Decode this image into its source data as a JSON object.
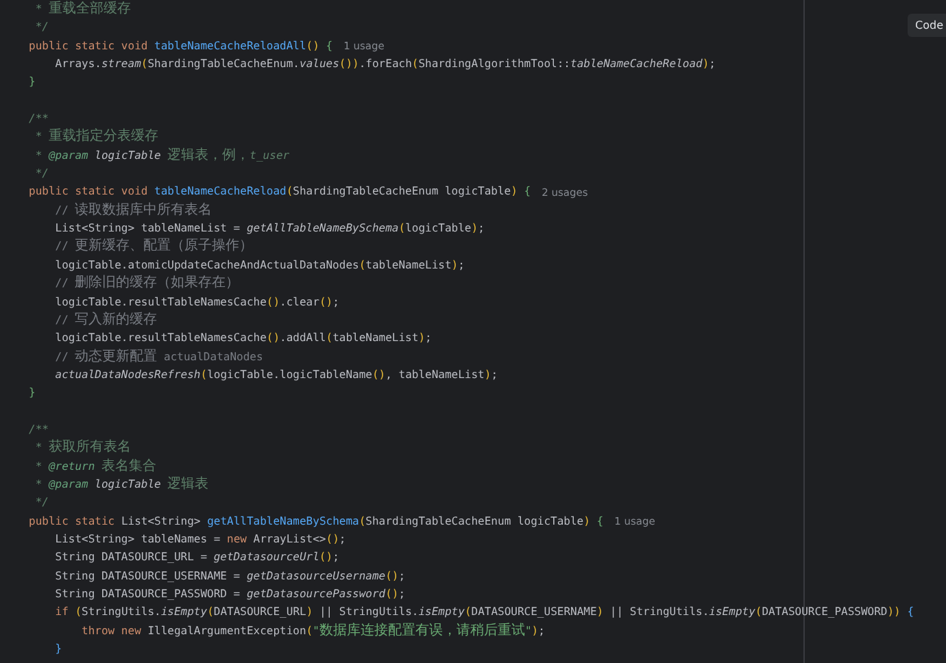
{
  "editor": {
    "lines": [
      {
        "kind": "code",
        "tokens": [
          {
            "text": " * 重载全部缓存",
            "kind": "doc"
          }
        ]
      },
      {
        "kind": "code",
        "tokens": [
          {
            "text": " */",
            "kind": "doc"
          }
        ]
      },
      {
        "kind": "code",
        "tokens": [
          {
            "text": "public static void ",
            "kind": "kw"
          },
          {
            "text": "tableNameCacheReloadAll",
            "kind": "decl"
          },
          {
            "text": "() ",
            "kind": "paren"
          },
          {
            "text": "{",
            "kind": "brace"
          }
        ],
        "hint": "1 usage"
      },
      {
        "kind": "code",
        "tokens": [
          {
            "text": "    Arrays.",
            "kind": "plain"
          },
          {
            "text": "stream",
            "kind": "static"
          },
          {
            "text": "(",
            "kind": "paren"
          },
          {
            "text": "ShardingTableCacheEnum.",
            "kind": "plain"
          },
          {
            "text": "values",
            "kind": "static"
          },
          {
            "text": "())",
            "kind": "paren"
          },
          {
            "text": ".forEach",
            "kind": "plain"
          },
          {
            "text": "(",
            "kind": "paren"
          },
          {
            "text": "ShardingAlgorithmTool::",
            "kind": "plain"
          },
          {
            "text": "tableNameCacheReload",
            "kind": "static"
          },
          {
            "text": ")",
            "kind": "paren"
          },
          {
            "text": ";",
            "kind": "plain"
          }
        ]
      },
      {
        "kind": "code",
        "tokens": [
          {
            "text": "}",
            "kind": "brace"
          }
        ]
      },
      {
        "kind": "blank"
      },
      {
        "kind": "code",
        "tokens": [
          {
            "text": "/**",
            "kind": "doc"
          }
        ]
      },
      {
        "kind": "code",
        "tokens": [
          {
            "text": " * 重载指定分表缓存",
            "kind": "doc"
          }
        ]
      },
      {
        "kind": "code",
        "tokens": [
          {
            "text": " * ",
            "kind": "doc"
          },
          {
            "text": "@param ",
            "kind": "doctag"
          },
          {
            "text": "logicTable",
            "kind": "docparam"
          },
          {
            "text": " 逻辑表，例，t_user",
            "kind": "doc"
          }
        ]
      },
      {
        "kind": "code",
        "tokens": [
          {
            "text": " */",
            "kind": "doc"
          }
        ]
      },
      {
        "kind": "code",
        "tokens": [
          {
            "text": "public static void ",
            "kind": "kw"
          },
          {
            "text": "tableNameCacheReload",
            "kind": "decl"
          },
          {
            "text": "(",
            "kind": "paren"
          },
          {
            "text": "ShardingTableCacheEnum logicTable",
            "kind": "plain"
          },
          {
            "text": ") ",
            "kind": "paren"
          },
          {
            "text": "{",
            "kind": "brace"
          }
        ],
        "hint": "2 usages"
      },
      {
        "kind": "code",
        "tokens": [
          {
            "text": "    // 读取数据库中所有表名",
            "kind": "comment"
          }
        ]
      },
      {
        "kind": "code",
        "tokens": [
          {
            "text": "    List<String> tableNameList = ",
            "kind": "plain"
          },
          {
            "text": "getAllTableNameBySchema",
            "kind": "static"
          },
          {
            "text": "(",
            "kind": "paren"
          },
          {
            "text": "logicTable",
            "kind": "plain"
          },
          {
            "text": ")",
            "kind": "paren"
          },
          {
            "text": ";",
            "kind": "plain"
          }
        ]
      },
      {
        "kind": "code",
        "tokens": [
          {
            "text": "    // 更新缓存、配置（原子操作）",
            "kind": "comment"
          }
        ]
      },
      {
        "kind": "code",
        "tokens": [
          {
            "text": "    logicTable.atomicUpdateCacheAndActualDataNodes",
            "kind": "plain"
          },
          {
            "text": "(",
            "kind": "paren"
          },
          {
            "text": "tableNameList",
            "kind": "plain"
          },
          {
            "text": ")",
            "kind": "paren"
          },
          {
            "text": ";",
            "kind": "plain"
          }
        ]
      },
      {
        "kind": "code",
        "tokens": [
          {
            "text": "    // 删除旧的缓存（如果存在）",
            "kind": "comment"
          }
        ]
      },
      {
        "kind": "code",
        "tokens": [
          {
            "text": "    logicTable.resultTableNamesCache",
            "kind": "plain"
          },
          {
            "text": "()",
            "kind": "paren"
          },
          {
            "text": ".clear",
            "kind": "plain"
          },
          {
            "text": "()",
            "kind": "paren"
          },
          {
            "text": ";",
            "kind": "plain"
          }
        ]
      },
      {
        "kind": "code",
        "tokens": [
          {
            "text": "    // 写入新的缓存",
            "kind": "comment"
          }
        ]
      },
      {
        "kind": "code",
        "tokens": [
          {
            "text": "    logicTable.resultTableNamesCache",
            "kind": "plain"
          },
          {
            "text": "()",
            "kind": "paren"
          },
          {
            "text": ".addAll",
            "kind": "plain"
          },
          {
            "text": "(",
            "kind": "paren"
          },
          {
            "text": "tableNameList",
            "kind": "plain"
          },
          {
            "text": ")",
            "kind": "paren"
          },
          {
            "text": ";",
            "kind": "plain"
          }
        ]
      },
      {
        "kind": "code",
        "tokens": [
          {
            "text": "    // 动态更新配置 actualDataNodes",
            "kind": "comment"
          }
        ]
      },
      {
        "kind": "code",
        "tokens": [
          {
            "text": "    actualDataNodesRefresh",
            "kind": "static"
          },
          {
            "text": "(",
            "kind": "paren"
          },
          {
            "text": "logicTable.logicTableName",
            "kind": "plain"
          },
          {
            "text": "()",
            "kind": "paren"
          },
          {
            "text": ", tableNameList",
            "kind": "plain"
          },
          {
            "text": ")",
            "kind": "paren"
          },
          {
            "text": ";",
            "kind": "plain"
          }
        ]
      },
      {
        "kind": "code",
        "tokens": [
          {
            "text": "}",
            "kind": "brace"
          }
        ]
      },
      {
        "kind": "blank"
      },
      {
        "kind": "code",
        "tokens": [
          {
            "text": "/**",
            "kind": "doc"
          }
        ]
      },
      {
        "kind": "code",
        "tokens": [
          {
            "text": " * 获取所有表名",
            "kind": "doc"
          }
        ]
      },
      {
        "kind": "code",
        "tokens": [
          {
            "text": " * ",
            "kind": "doc"
          },
          {
            "text": "@return",
            "kind": "doctag"
          },
          {
            "text": " 表名集合",
            "kind": "doc"
          }
        ]
      },
      {
        "kind": "code",
        "tokens": [
          {
            "text": " * ",
            "kind": "doc"
          },
          {
            "text": "@param ",
            "kind": "doctag"
          },
          {
            "text": "logicTable",
            "kind": "docparam"
          },
          {
            "text": " 逻辑表",
            "kind": "doc"
          }
        ]
      },
      {
        "kind": "code",
        "tokens": [
          {
            "text": " */",
            "kind": "doc"
          }
        ]
      },
      {
        "kind": "code",
        "tokens": [
          {
            "text": "public static ",
            "kind": "kw"
          },
          {
            "text": "List<String> ",
            "kind": "plain"
          },
          {
            "text": "getAllTableNameBySchema",
            "kind": "decl"
          },
          {
            "text": "(",
            "kind": "paren"
          },
          {
            "text": "ShardingTableCacheEnum logicTable",
            "kind": "plain"
          },
          {
            "text": ") ",
            "kind": "paren"
          },
          {
            "text": "{",
            "kind": "brace"
          }
        ],
        "hint": "1 usage"
      },
      {
        "kind": "code",
        "tokens": [
          {
            "text": "    List<String> tableNames = ",
            "kind": "plain"
          },
          {
            "text": "new ",
            "kind": "kw"
          },
          {
            "text": "ArrayList<>",
            "kind": "plain"
          },
          {
            "text": "()",
            "kind": "paren"
          },
          {
            "text": ";",
            "kind": "plain"
          }
        ]
      },
      {
        "kind": "code",
        "tokens": [
          {
            "text": "    String DATASOURCE_URL = ",
            "kind": "plain"
          },
          {
            "text": "getDatasourceUrl",
            "kind": "static"
          },
          {
            "text": "()",
            "kind": "paren"
          },
          {
            "text": ";",
            "kind": "plain"
          }
        ]
      },
      {
        "kind": "code",
        "tokens": [
          {
            "text": "    String DATASOURCE_USERNAME = ",
            "kind": "plain"
          },
          {
            "text": "getDatasourceUsername",
            "kind": "static"
          },
          {
            "text": "()",
            "kind": "paren"
          },
          {
            "text": ";",
            "kind": "plain"
          }
        ]
      },
      {
        "kind": "code",
        "tokens": [
          {
            "text": "    String DATASOURCE_PASSWORD = ",
            "kind": "plain"
          },
          {
            "text": "getDatasourcePassword",
            "kind": "static"
          },
          {
            "text": "()",
            "kind": "paren"
          },
          {
            "text": ";",
            "kind": "plain"
          }
        ]
      },
      {
        "kind": "code",
        "tokens": [
          {
            "text": "    if ",
            "kind": "kw"
          },
          {
            "text": "(",
            "kind": "paren"
          },
          {
            "text": "StringUtils.",
            "kind": "plain"
          },
          {
            "text": "isEmpty",
            "kind": "static"
          },
          {
            "text": "(",
            "kind": "paren"
          },
          {
            "text": "DATASOURCE_URL",
            "kind": "plain"
          },
          {
            "text": ")",
            "kind": "paren"
          },
          {
            "text": " || StringUtils.",
            "kind": "plain"
          },
          {
            "text": "isEmpty",
            "kind": "static"
          },
          {
            "text": "(",
            "kind": "paren"
          },
          {
            "text": "DATASOURCE_USERNAME",
            "kind": "plain"
          },
          {
            "text": ")",
            "kind": "paren"
          },
          {
            "text": " || StringUtils.",
            "kind": "plain"
          },
          {
            "text": "isEmpty",
            "kind": "static"
          },
          {
            "text": "(",
            "kind": "paren"
          },
          {
            "text": "DATASOURCE_PASSWORD",
            "kind": "plain"
          },
          {
            "text": ")) ",
            "kind": "paren"
          },
          {
            "text": "{",
            "kind": "brace2"
          }
        ]
      },
      {
        "kind": "code",
        "tokens": [
          {
            "text": "        throw new ",
            "kind": "kw"
          },
          {
            "text": "IllegalArgumentException",
            "kind": "plain"
          },
          {
            "text": "(",
            "kind": "paren"
          },
          {
            "text": "\"数据库连接配置有误，请稍后重试\"",
            "kind": "string"
          },
          {
            "text": ")",
            "kind": "paren"
          },
          {
            "text": ";",
            "kind": "plain"
          }
        ]
      },
      {
        "kind": "code",
        "tokens": [
          {
            "text": "    }",
            "kind": "brace2"
          }
        ]
      }
    ]
  },
  "toolbar": {
    "button": "Code"
  }
}
